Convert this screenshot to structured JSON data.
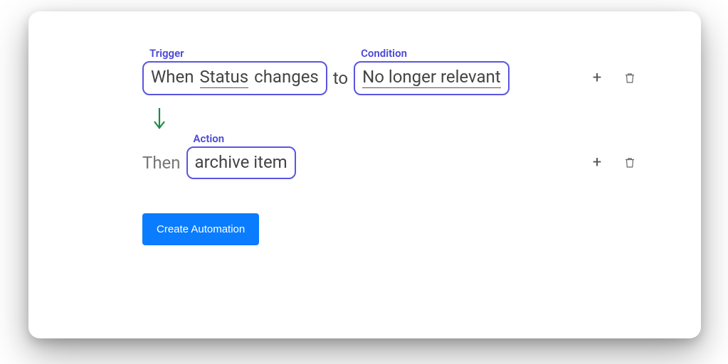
{
  "labels": {
    "trigger": "Trigger",
    "condition": "Condition",
    "action": "Action"
  },
  "trigger": {
    "prefix": "When",
    "field": "Status",
    "verb": "changes",
    "joiner": "to"
  },
  "condition": {
    "value": "No longer relevant"
  },
  "action": {
    "prefix": "Then",
    "value": "archive item"
  },
  "buttons": {
    "create": "Create Automation"
  },
  "icons": {
    "plus": "plus-icon",
    "trash": "trash-icon",
    "arrow_down": "arrow-down-icon"
  }
}
